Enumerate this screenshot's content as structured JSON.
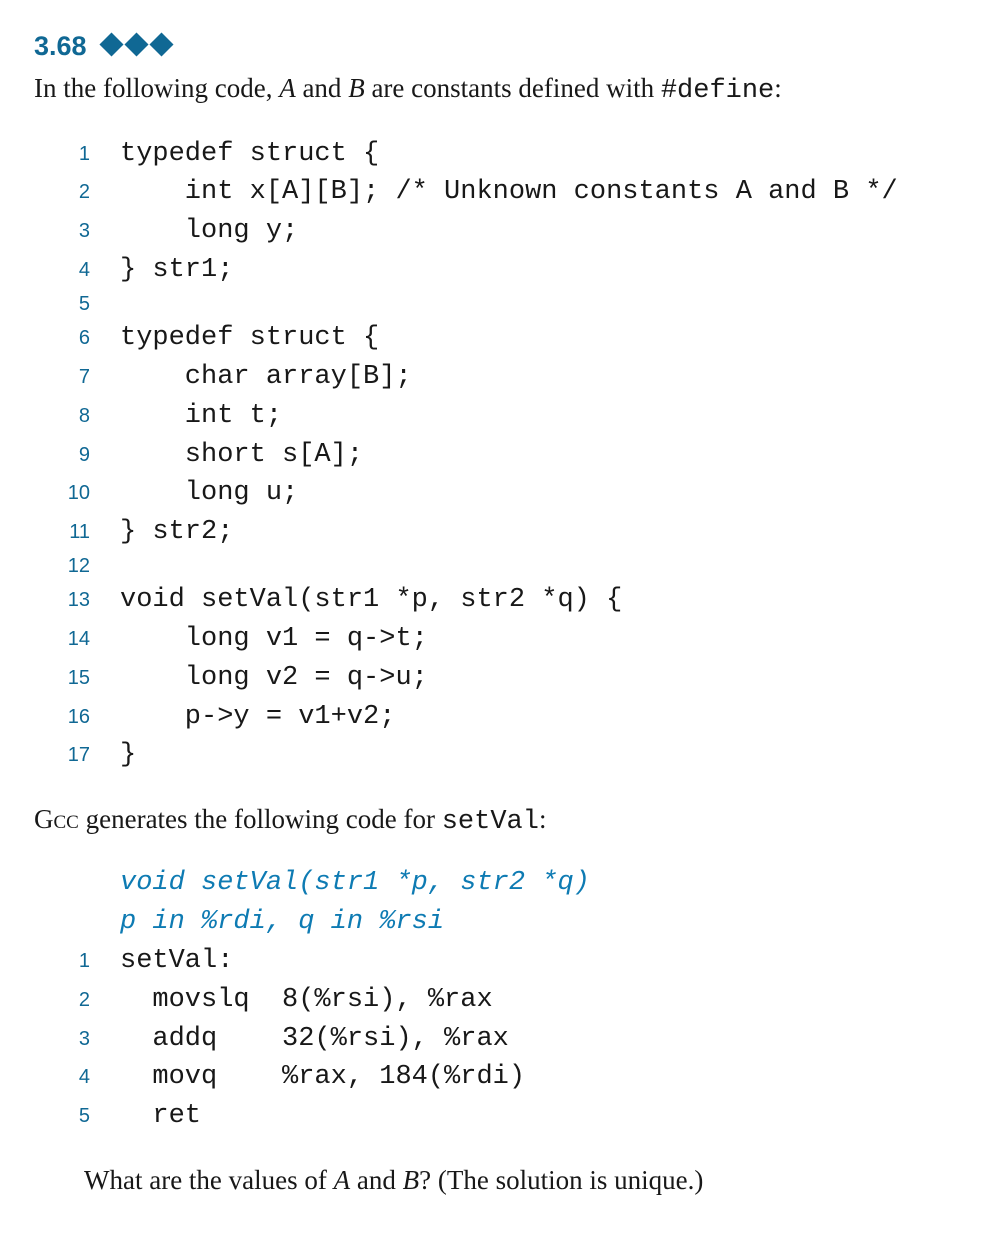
{
  "label": "3.68",
  "intro": {
    "before_A": "In the following code, ",
    "A": "A",
    "between": " and ",
    "B": "B",
    "after_B": " are constants defined with ",
    "define": "#define",
    "end": ":"
  },
  "c_code": [
    {
      "n": "1",
      "t": "typedef struct {"
    },
    {
      "n": "2",
      "t": "    int x[A][B]; /* Unknown constants A and B */"
    },
    {
      "n": "3",
      "t": "    long y;"
    },
    {
      "n": "4",
      "t": "} str1;"
    },
    {
      "n": "5",
      "t": ""
    },
    {
      "n": "6",
      "t": "typedef struct {"
    },
    {
      "n": "7",
      "t": "    char array[B];"
    },
    {
      "n": "8",
      "t": "    int t;"
    },
    {
      "n": "9",
      "t": "    short s[A];"
    },
    {
      "n": "10",
      "t": "    long u;"
    },
    {
      "n": "11",
      "t": "} str2;"
    },
    {
      "n": "12",
      "t": ""
    },
    {
      "n": "13",
      "t": "void setVal(str1 *p, str2 *q) {"
    },
    {
      "n": "14",
      "t": "    long v1 = q->t;"
    },
    {
      "n": "15",
      "t": "    long v2 = q->u;"
    },
    {
      "n": "16",
      "t": "    p->y = v1+v2;"
    },
    {
      "n": "17",
      "t": "}"
    }
  ],
  "mid": {
    "before": "G",
    "sc": "cc",
    "after": " generates the following code for ",
    "fn": "setVal",
    "end": ":"
  },
  "asm_comments": [
    "void setVal(str1 *p, str2 *q)",
    "p in %rdi, q in %rsi"
  ],
  "asm": [
    {
      "n": "1",
      "t": "setVal:"
    },
    {
      "n": "2",
      "t": "  movslq  8(%rsi), %rax"
    },
    {
      "n": "3",
      "t": "  addq    32(%rsi), %rax"
    },
    {
      "n": "4",
      "t": "  movq    %rax, 184(%rdi)"
    },
    {
      "n": "5",
      "t": "  ret"
    }
  ],
  "question": {
    "before": "What are the values of ",
    "A": "A",
    "and": " and ",
    "B": "B",
    "after": "? (The solution is unique.)"
  }
}
